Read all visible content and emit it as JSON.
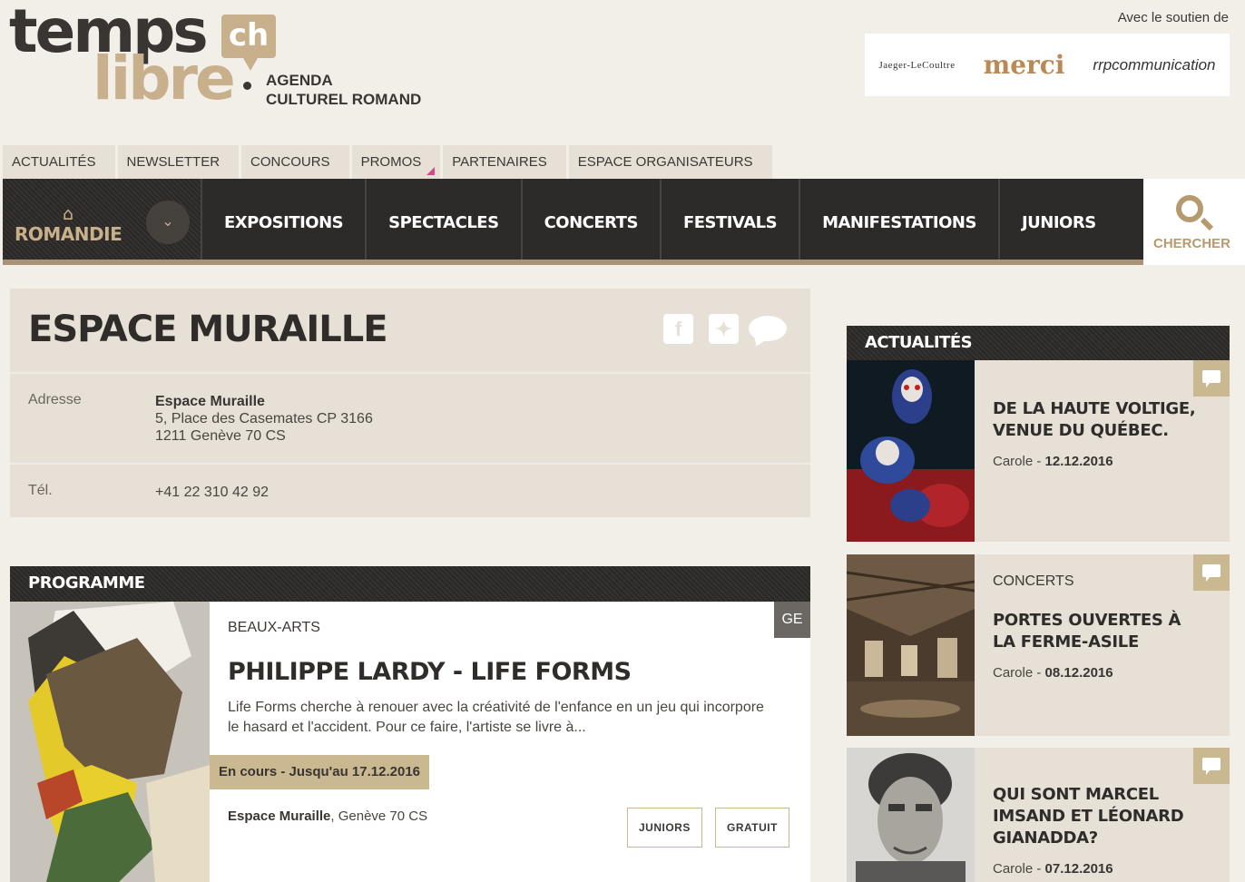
{
  "brand": {
    "logo_top": "temps",
    "logo_bottom": "libre",
    "logo_badge": "ch",
    "tagline_line1": "AGENDA",
    "tagline_line2": "CULTUREL ROMAND"
  },
  "sponsors": {
    "label": "Avec le soutien de",
    "items": [
      "Jaeger-LeCoultre",
      "merci",
      "rrpcommunication"
    ]
  },
  "top_nav": [
    "Actualités",
    "Newsletter",
    "Concours",
    "Promos",
    "Partenaires",
    "Espace organisateurs"
  ],
  "main_nav": {
    "region": "ROMANDIE",
    "items": [
      "EXPOSITIONS",
      "SPECTACLES",
      "CONCERTS",
      "FESTIVALS",
      "MANIFESTATIONS",
      "JUNIORS"
    ],
    "search": "CHERCHER"
  },
  "venue": {
    "title": "ESPACE MURAILLE",
    "address_label": "Adresse",
    "address_name": "Espace Muraille",
    "address_line1": "5, Place des Casemates CP 3166",
    "address_line2": "1211 Genève 70 CS",
    "phone_label": "Tél.",
    "phone": "+41 22 310 42 92"
  },
  "programme": {
    "heading": "PROGRAMME",
    "region": "GE",
    "category": "BEAUX-ARTS",
    "title": "PHILIPPE LARDY - LIFE FORMS",
    "description": "Life Forms cherche à renouer avec la créativité de l'enfance en un jeu qui incorpore le hasard et l'accident. Pour ce faire, l'artiste se livre à...",
    "date": "En cours - Jusqu'au 17.12.2016",
    "venue_name": "Espace Muraille",
    "venue_city": ", Genève 70 CS",
    "tags": [
      "JUNIORS",
      "GRATUIT"
    ]
  },
  "sidebar": {
    "heading": "ACTUALITÉS",
    "news": [
      {
        "category": "",
        "title": "DE LA HAUTE VOLTIGE, VENUE DU QUÉBEC.",
        "author": "Carole - ",
        "date": "12.12.2016"
      },
      {
        "category": "CONCERTS",
        "title": "PORTES OUVERTES À LA FERME-ASILE",
        "author": "Carole - ",
        "date": "08.12.2016"
      },
      {
        "category": "",
        "title": "QUI SONT MARCEL IMSAND ET LÉONARD GIANADDA?",
        "author": "Carole - ",
        "date": "07.12.2016"
      }
    ]
  },
  "colors": {
    "accent_gold": "#c9b08c",
    "dark": "#2d2b2a",
    "beige_panel": "#e6e0d6",
    "page_bg": "#f2eee8",
    "promo_flag": "#d6468c"
  }
}
